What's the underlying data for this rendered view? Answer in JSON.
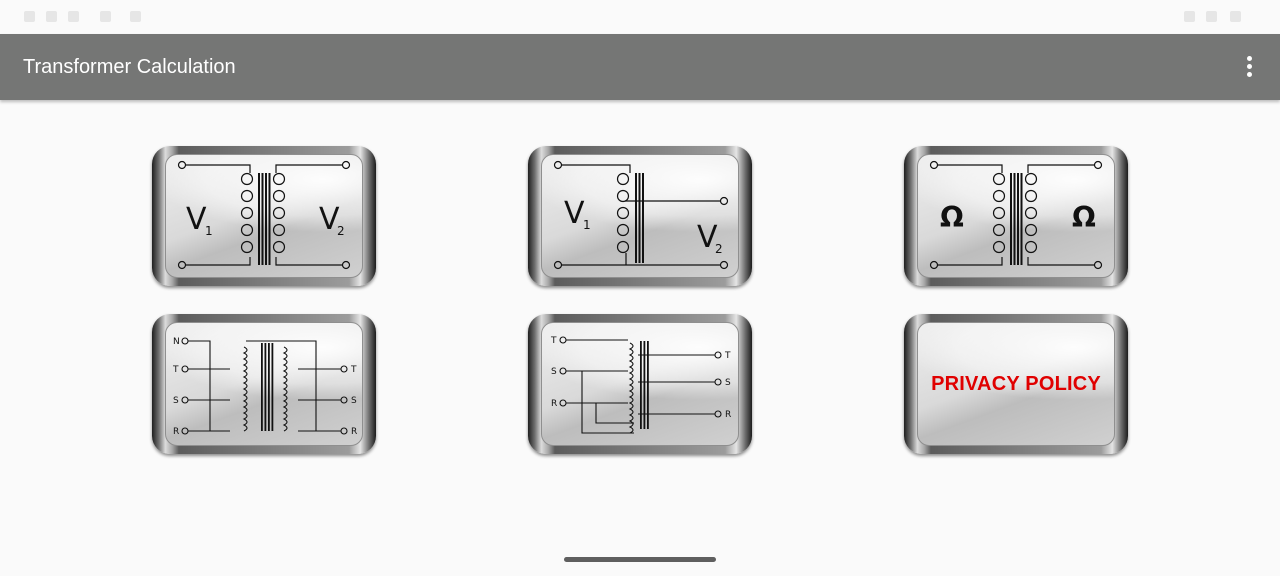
{
  "app_bar": {
    "title": "Transformer Calculation",
    "overflow_icon": "more-vert-icon"
  },
  "tiles": [
    {
      "icon": "single-phase-transformer-voltage-icon",
      "v_in": "V",
      "v_in_sub": "1",
      "v_out": "V",
      "v_out_sub": "2"
    },
    {
      "icon": "autotransformer-voltage-icon",
      "v_in": "V",
      "v_in_sub": "1",
      "v_out": "V",
      "v_out_sub": "2"
    },
    {
      "icon": "transformer-impedance-icon",
      "left_symbol": "Ω",
      "right_symbol": "Ω"
    },
    {
      "icon": "three-phase-transformer-icon",
      "left_terminals": [
        "N",
        "T",
        "S",
        "R"
      ],
      "right_terminals": [
        "T",
        "S",
        "R"
      ]
    },
    {
      "icon": "three-phase-autotransformer-icon",
      "left_terminals": [
        "T",
        "S",
        "R"
      ],
      "right_terminals": [
        "T",
        "S",
        "R"
      ]
    },
    {
      "icon": "privacy-policy-icon",
      "label": "PRIVACY POLICY"
    }
  ],
  "colors": {
    "app_bar": "#757675",
    "privacy_label": "#e00000",
    "background": "#fafafa"
  }
}
